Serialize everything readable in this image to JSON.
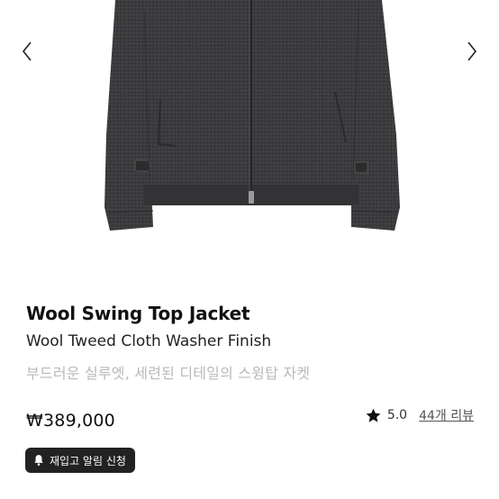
{
  "gallery": {
    "prev_icon": "chevron-left-icon",
    "next_icon": "chevron-right-icon",
    "image_alt": "Wool Swing Top Jacket"
  },
  "product": {
    "title": "Wool Swing Top Jacket",
    "subtitle": "Wool Tweed Cloth Washer Finish",
    "description": "부드러운 실루엣, 세련된 디테일의 스윙탑 자켓",
    "price": "₩389,000",
    "rating": {
      "icon": "star-icon",
      "score": "5.0",
      "reviews_label": "44개 리뷰"
    },
    "restock": {
      "icon": "bell-icon",
      "label": "재입고 알림 신청"
    }
  },
  "colors": {
    "jacket": "#3a3a3c",
    "price_text": "#111111",
    "description_text": "#b9b9b9",
    "button_bg": "#222222"
  }
}
